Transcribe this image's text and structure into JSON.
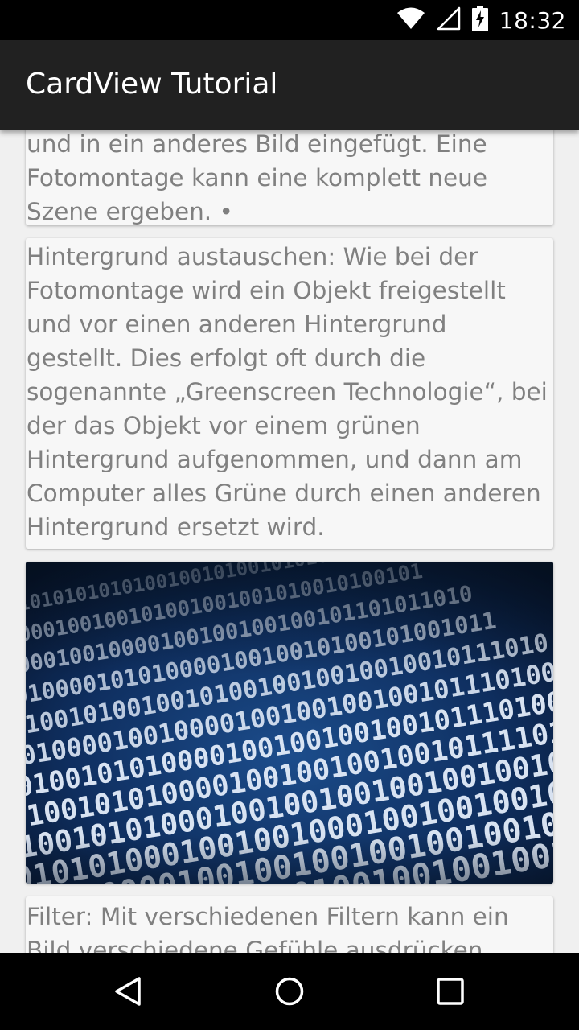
{
  "status_bar": {
    "time": "18:32",
    "icons": [
      "wifi-icon",
      "signal-icon",
      "battery-charging-icon"
    ]
  },
  "app_bar": {
    "title": "CardView Tutorial"
  },
  "cards": [
    {
      "type": "text",
      "text": "Fotomontage: Ein Objekt wird freigestellt und in ein anderes Bild eingefügt. Eine Fotomontage kann eine komplett neue Szene ergeben. •"
    },
    {
      "type": "text",
      "text": "Hintergrund austauschen: Wie bei der Fotomontage wird ein Objekt freigestellt und vor einen anderen Hintergrund gestellt. Dies erfolgt oft durch die sogenannte „Greenscreen Technologie“, bei der das Objekt vor einem grünen Hintergrund aufgenommen, und dann am Computer alles Grüne durch einen anderen Hintergrund ersetzt wird."
    },
    {
      "type": "image",
      "image": "binary-code-image",
      "rows": [
        "10101010101010100100101001010100101",
        "010000100100101001001001010010100101",
        "1000010010000100100100100101101011010",
        "0101000010101000010010010100101001011",
        "00100101001001010010010010010010111010",
        "0010000100100001001001001001011101001",
        "1010010101000010010010010010111010010",
        "010010101000010010010010010111101001",
        "10010101000100100100100100100101111",
        "01010100010010010001001001001010010",
        "0101000010010010010010010010010111",
        "1010101010000010010010010010010"
      ]
    },
    {
      "type": "text",
      "text": "Filter: Mit verschiedenen Filtern kann ein Bild verschiedene Gefühle ausdrücken."
    }
  ],
  "nav_bar": {
    "buttons": [
      "back-icon",
      "home-icon",
      "recents-icon"
    ]
  },
  "colors": {
    "status_bar": "#000000",
    "app_bar": "#212121",
    "background": "#f0f0f0",
    "card": "#f7f7f7",
    "card_text": "#808080",
    "nav_bar": "#000000"
  }
}
